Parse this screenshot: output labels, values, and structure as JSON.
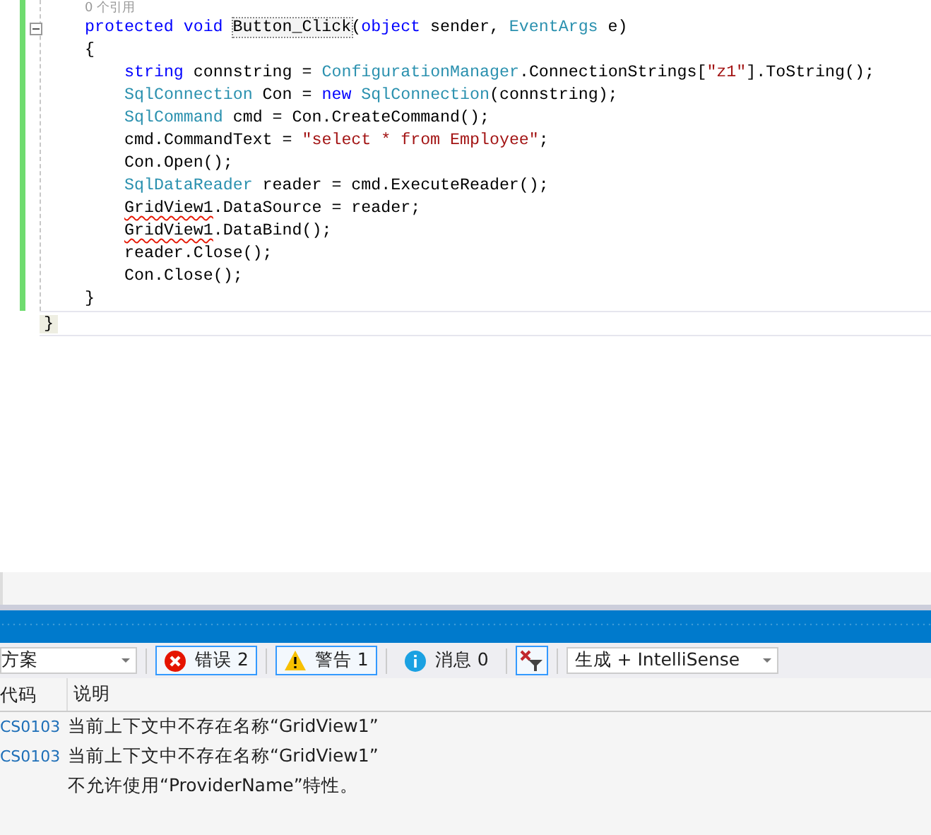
{
  "editor": {
    "code_lens": "0 个引用",
    "lines": [
      {
        "tokens": [
          {
            "kind": "keyword",
            "text": "protected void "
          },
          {
            "kind": "highlight",
            "text": "Button_Click"
          },
          {
            "kind": "plain",
            "text": "("
          },
          {
            "kind": "keyword",
            "text": "object"
          },
          {
            "kind": "plain",
            "text": " sender, "
          },
          {
            "kind": "type",
            "text": "EventArgs"
          },
          {
            "kind": "plain",
            "text": " e)"
          }
        ]
      },
      {
        "tokens": [
          {
            "kind": "plain",
            "text": "{"
          }
        ],
        "children": [
          {
            "tokens": [
              {
                "kind": "keyword",
                "text": "string"
              },
              {
                "kind": "plain",
                "text": " connstring = "
              },
              {
                "kind": "type",
                "text": "ConfigurationManager"
              },
              {
                "kind": "plain",
                "text": ".ConnectionStrings["
              },
              {
                "kind": "string",
                "text": "\"z1\""
              },
              {
                "kind": "plain",
                "text": "].ToString();"
              }
            ]
          },
          {
            "tokens": [
              {
                "kind": "type",
                "text": "SqlConnection"
              },
              {
                "kind": "plain",
                "text": " Con = "
              },
              {
                "kind": "keyword",
                "text": "new "
              },
              {
                "kind": "type",
                "text": "SqlConnection"
              },
              {
                "kind": "plain",
                "text": "(connstring);"
              }
            ]
          },
          {
            "tokens": [
              {
                "kind": "type",
                "text": "SqlCommand"
              },
              {
                "kind": "plain",
                "text": " cmd = Con.CreateCommand();"
              }
            ]
          },
          {
            "tokens": [
              {
                "kind": "plain",
                "text": "cmd.CommandText = "
              },
              {
                "kind": "string",
                "text": "\"select * from Employee\""
              },
              {
                "kind": "plain",
                "text": ";"
              }
            ]
          },
          {
            "tokens": [
              {
                "kind": "plain",
                "text": "Con.Open();"
              }
            ]
          },
          {
            "tokens": [
              {
                "kind": "type",
                "text": "SqlDataReader"
              },
              {
                "kind": "plain",
                "text": " reader = cmd.ExecuteReader();"
              }
            ]
          },
          {
            "tokens": [
              {
                "kind": "error",
                "text": "GridView1"
              },
              {
                "kind": "plain",
                "text": ".DataSource = reader;"
              }
            ]
          },
          {
            "tokens": [
              {
                "kind": "error",
                "text": "GridView1"
              },
              {
                "kind": "plain",
                "text": ".DataBind();"
              }
            ]
          },
          {
            "tokens": [
              {
                "kind": "plain",
                "text": "reader.Close();"
              }
            ]
          },
          {
            "tokens": [
              {
                "kind": "plain",
                "text": "Con.Close();"
              }
            ]
          }
        ]
      },
      {
        "tokens": [
          {
            "kind": "plain",
            "text": "}"
          }
        ]
      }
    ],
    "class_close": "}"
  },
  "error_list": {
    "scope": "方案",
    "filters": [
      {
        "kind": "error",
        "label": "错误 2",
        "selected": true
      },
      {
        "kind": "warning",
        "label": "警告 1",
        "selected": true
      },
      {
        "kind": "info",
        "label": "消息 0",
        "selected": false
      }
    ],
    "filter_toggle": {
      "selected": true
    },
    "source": "生成 + IntelliSense",
    "columns": [
      "代码",
      "说明"
    ],
    "rows": [
      {
        "code": "CS0103",
        "description": "当前上下文中不存在名称“GridView1”"
      },
      {
        "code": "CS0103",
        "description": "当前上下文中不存在名称“GridView1”"
      },
      {
        "description": "不允许使用“ProviderName”特性。"
      }
    ]
  }
}
